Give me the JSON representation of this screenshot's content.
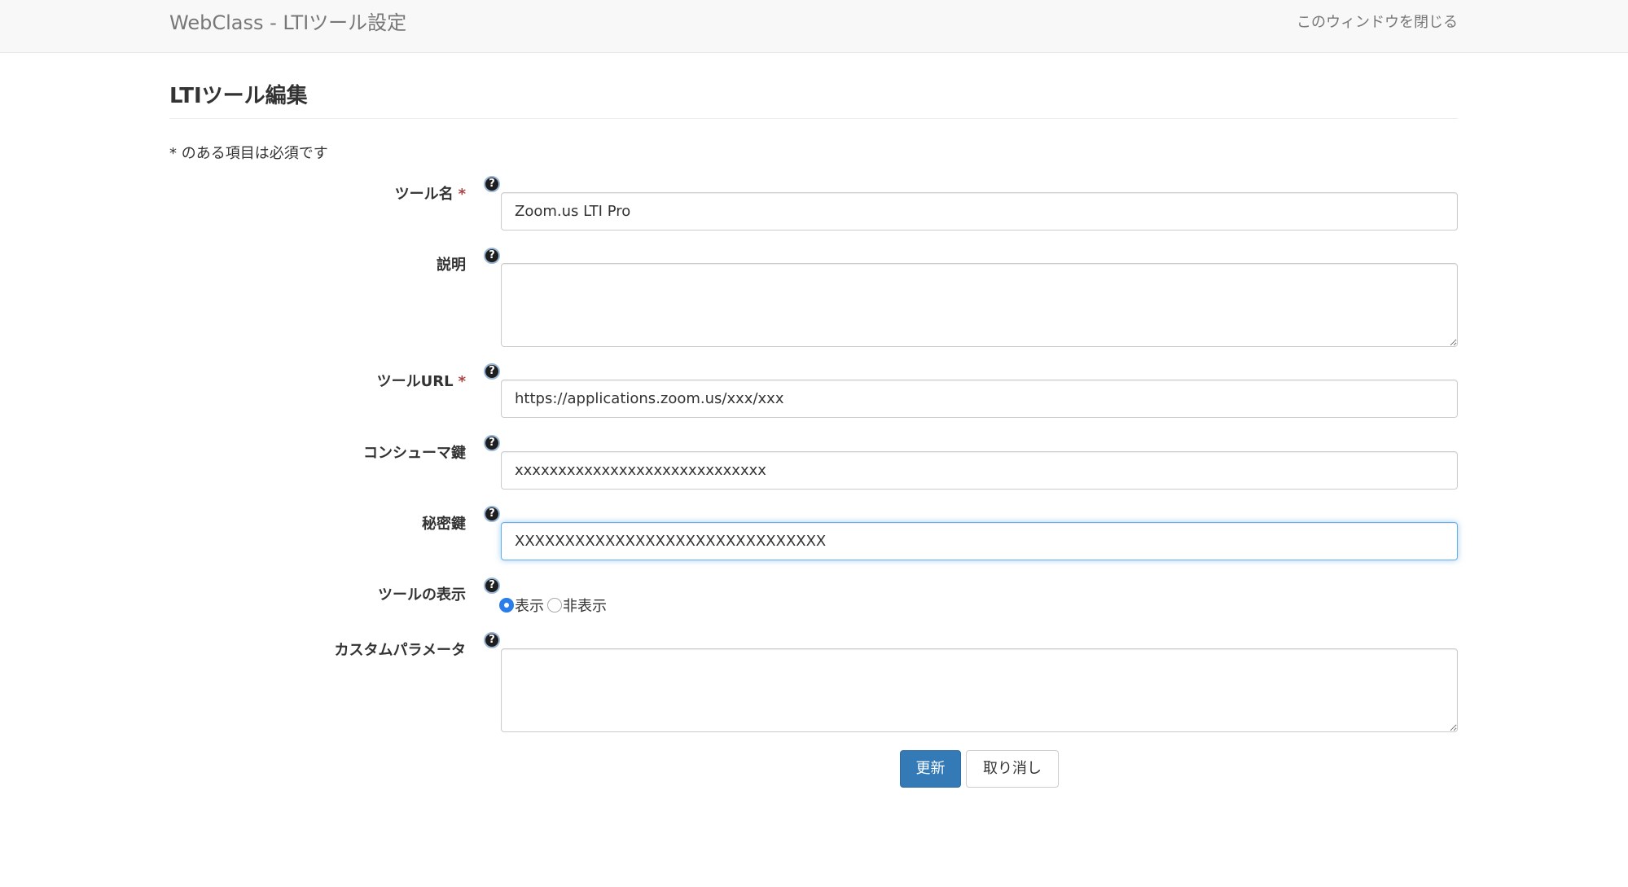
{
  "header": {
    "title": "WebClass - LTIツール設定",
    "close_link": "このウィンドウを閉じる"
  },
  "page": {
    "title": "LTIツール編集",
    "required_note": "* のある項目は必須です"
  },
  "form": {
    "help_glyph": "?",
    "required_marker": "*",
    "tool_name": {
      "label": "ツール名",
      "value": "Zoom.us LTI Pro"
    },
    "description": {
      "label": "説明",
      "value": ""
    },
    "tool_url": {
      "label": "ツールURL",
      "value": "https://applications.zoom.us/xxx/xxx"
    },
    "consumer_key": {
      "label": "コンシューマ鍵",
      "value": "xxxxxxxxxxxxxxxxxxxxxxxxxxxxx"
    },
    "secret_key": {
      "label": "秘密鍵",
      "value": "XXXXXXXXXXXXXXXXXXXXXXXXXXXXXXX"
    },
    "display": {
      "label": "ツールの表示",
      "options": [
        "表示",
        "非表示"
      ],
      "selected": "表示"
    },
    "custom_params": {
      "label": "カスタムパラメータ",
      "value": ""
    }
  },
  "buttons": {
    "update": "更新",
    "cancel": "取り消し"
  },
  "colors": {
    "primary": "#337ab7",
    "required": "#a94442",
    "focus": "#66afe9"
  }
}
